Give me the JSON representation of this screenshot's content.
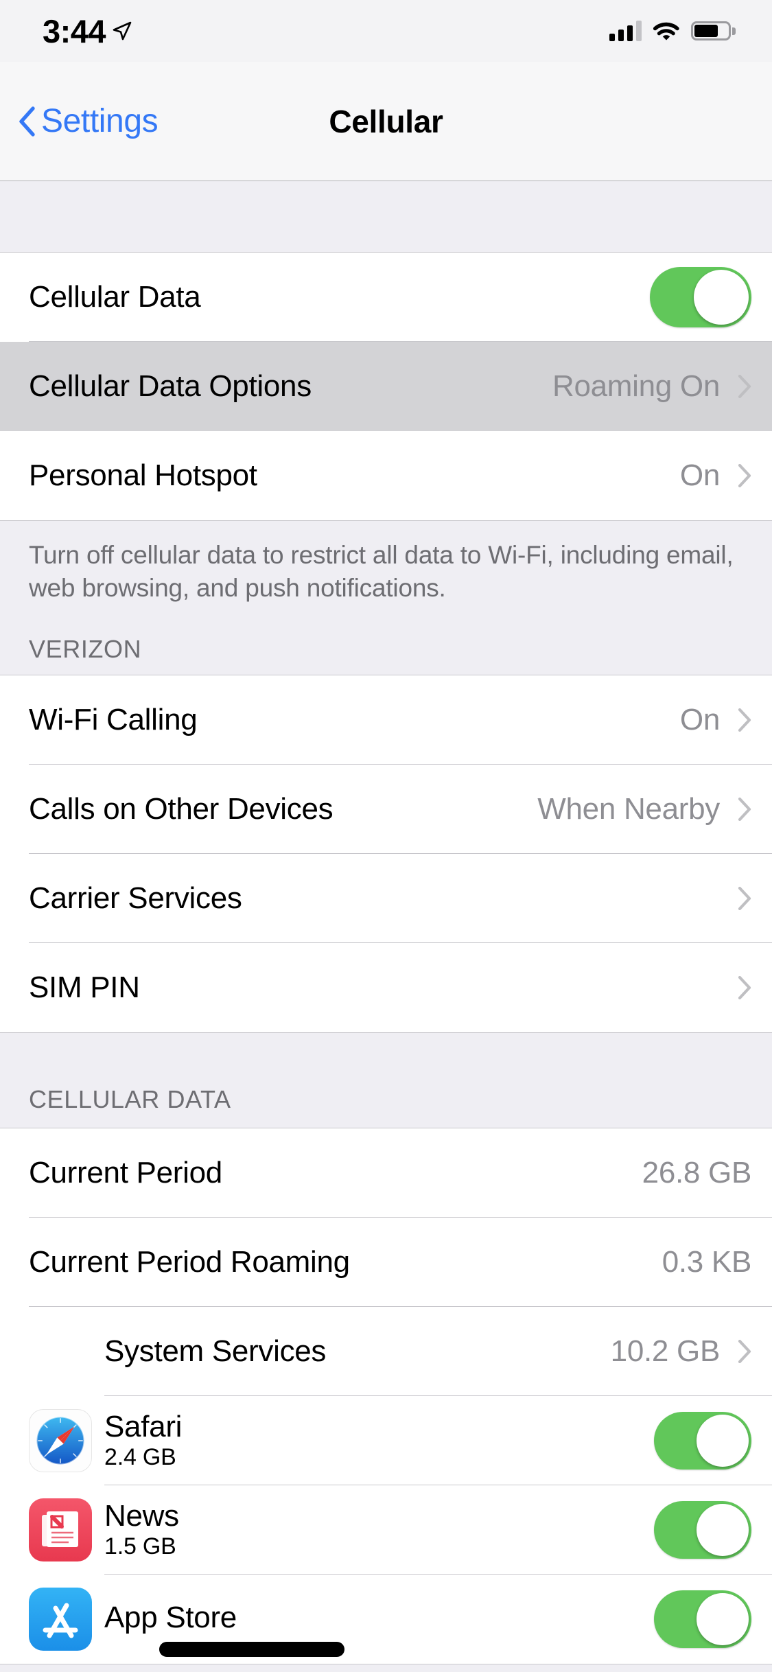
{
  "status_bar": {
    "time": "3:44",
    "location_icon": "location-arrow-icon",
    "signal_icon": "cellular-signal-icon",
    "signal_bars_filled": 3,
    "signal_bars_total": 4,
    "wifi_icon": "wifi-icon",
    "battery_icon": "battery-icon",
    "battery_level_percent": 75
  },
  "nav": {
    "back_label": "Settings",
    "back_icon": "chevron-left-icon",
    "title": "Cellular"
  },
  "sections": {
    "data_group": {
      "rows": [
        {
          "label": "Cellular Data",
          "type": "toggle",
          "toggle_on": true
        },
        {
          "label": "Cellular Data Options",
          "value": "Roaming On",
          "type": "disclosure",
          "pressed": true
        },
        {
          "label": "Personal Hotspot",
          "value": "On",
          "type": "disclosure",
          "pressed": false
        }
      ],
      "footer": "Turn off cellular data to restrict all data to Wi-Fi, including email, web browsing, and push notifications."
    },
    "carrier": {
      "header": "VERIZON",
      "rows": [
        {
          "label": "Wi-Fi Calling",
          "value": "On",
          "type": "disclosure"
        },
        {
          "label": "Calls on Other Devices",
          "value": "When Nearby",
          "type": "disclosure"
        },
        {
          "label": "Carrier Services",
          "value": "",
          "type": "disclosure"
        },
        {
          "label": "SIM PIN",
          "value": "",
          "type": "disclosure"
        }
      ]
    },
    "cellular_data": {
      "header": "CELLULAR DATA",
      "rows": [
        {
          "label": "Current Period",
          "value": "26.8 GB",
          "type": "value"
        },
        {
          "label": "Current Period Roaming",
          "value": "0.3 KB",
          "type": "value"
        },
        {
          "label": "System Services",
          "value": "10.2 GB",
          "type": "disclosure",
          "indent": true
        }
      ],
      "apps": [
        {
          "name": "Safari",
          "size": "2.4 GB",
          "icon": "safari-icon",
          "toggle_on": true
        },
        {
          "name": "News",
          "size": "1.5 GB",
          "icon": "news-icon",
          "toggle_on": true
        },
        {
          "name": "App Store",
          "size": "",
          "icon": "app-store-icon",
          "toggle_on": true
        }
      ]
    }
  },
  "colors": {
    "accent_blue": "#3478F6",
    "toggle_green": "#61C75A",
    "group_bg": "#EFEEF3",
    "secondary_text": "#8E8E93",
    "separator": "#C8C7CC"
  },
  "home_indicator": "home-indicator"
}
